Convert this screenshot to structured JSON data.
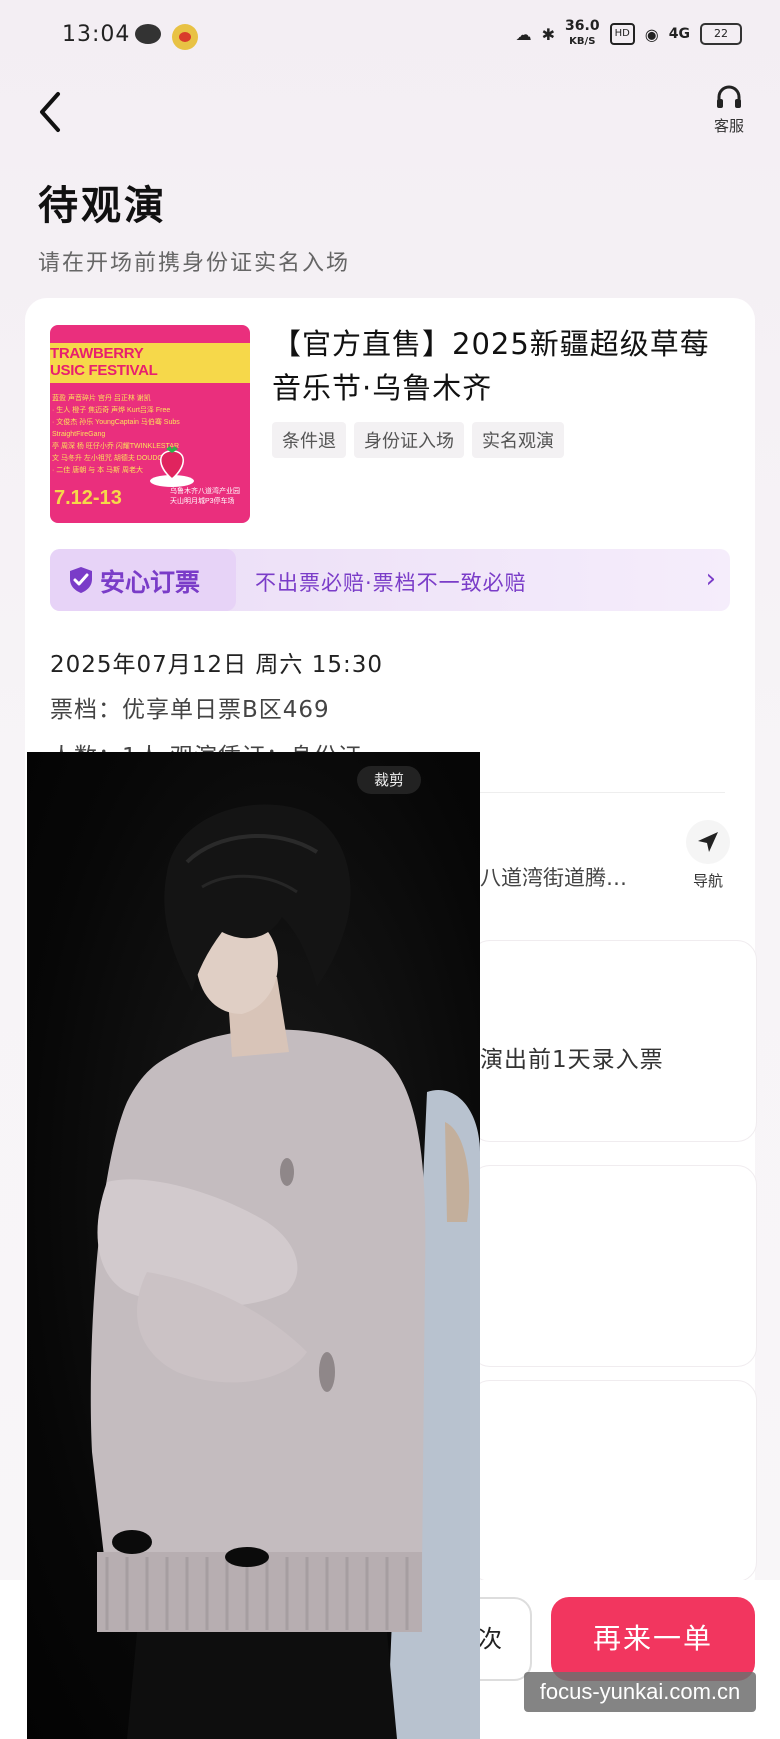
{
  "status_bar": {
    "time": "13:04",
    "network_speed_value": "36.0",
    "network_speed_unit": "KB/S",
    "hd_label": "HD",
    "signal_label": "4G",
    "battery_label": "22"
  },
  "header": {
    "service_label": "客服"
  },
  "page": {
    "title": "待观演",
    "subtitle": "请在开场前携身份证实名入场"
  },
  "poster": {
    "title_line1": "TRAWBERRY",
    "title_line2": "USIC FESTIVAL",
    "date": "7.12-13",
    "lineup_lines": [
      "蓝盈 声音碎片 宫丹 吕正林 谢凯",
      "· 生人 橙子 焦迈奇 声烨 Kurt吕泽 Free",
      "· 文俊杰 孙乐 YoungCaptain 马伯骞 Subs",
      "StraightFireGang",
      "亭 周深 杨 旺仔小乔 闪耀TWINKLESTAR",
      "文 马冬升 左小祖咒 胡德夫 DOUDOU 杰",
      "· 二佳 唐朝 与 本 马斯 周老大"
    ],
    "venue": "乌鲁木齐八道湾产业园 天山明月城P3停车场"
  },
  "event": {
    "title": "【官方直售】2025新疆超级草莓音乐节·乌鲁木齐",
    "tags": [
      "条件退",
      "身份证入场",
      "实名观演"
    ]
  },
  "assurance": {
    "label": "安心订票",
    "description": "不出票必赔·票档不一致必赔"
  },
  "order_info": {
    "datetime": "2025年07月12日 周六 15:30",
    "tier": "票档：优享单日票B区469",
    "count": "人数：1人   观演凭证：身份证"
  },
  "address": {
    "text": "八道湾街道腾…",
    "nav_label": "导航"
  },
  "ticket_note": "演出前1天录入票",
  "photo": {
    "crop_label": "裁剪"
  },
  "bottom": {
    "secondary_label": "次",
    "reorder_label": "再来一单"
  },
  "watermark": "focus-yunkai.com.cn",
  "colors": {
    "accent_red": "#f2365f",
    "assurance_purple": "#7a3cc8",
    "poster_pink": "#ea2f7d",
    "poster_yellow": "#f6d84a"
  }
}
